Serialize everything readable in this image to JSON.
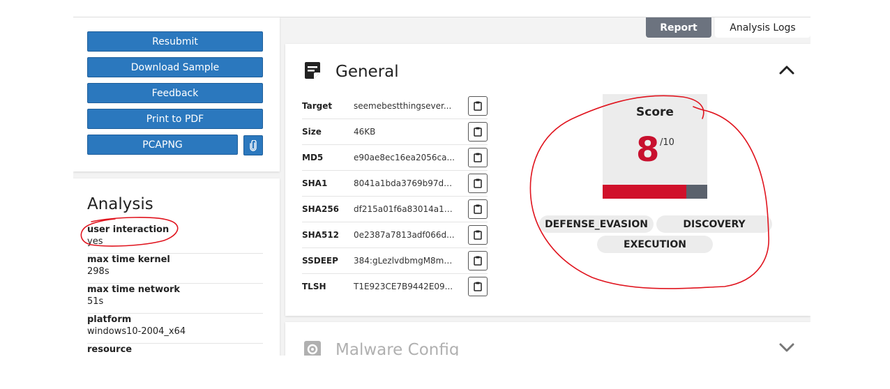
{
  "actions": {
    "resubmit": "Resubmit",
    "download": "Download Sample",
    "feedback": "Feedback",
    "print": "Print to PDF",
    "pcapng": "PCAPNG"
  },
  "analysis": {
    "title": "Analysis",
    "props": [
      {
        "key": "user interaction",
        "value": "yes"
      },
      {
        "key": "max time kernel",
        "value": "298s"
      },
      {
        "key": "max time network",
        "value": "51s"
      },
      {
        "key": "platform",
        "value": "windows10-2004_x64"
      },
      {
        "key": "resource",
        "value": ""
      }
    ]
  },
  "tabs": {
    "report": "Report",
    "logs": "Analysis Logs"
  },
  "general": {
    "title": "General",
    "rows": [
      {
        "key": "Target",
        "value": "seemebestthingsever..."
      },
      {
        "key": "Size",
        "value": "46KB"
      },
      {
        "key": "MD5",
        "value": "e90ae8ec16ea2056ca..."
      },
      {
        "key": "SHA1",
        "value": "8041a1bda3769b97d8..."
      },
      {
        "key": "SHA256",
        "value": "df215a01f6a83014a14..."
      },
      {
        "key": "SHA512",
        "value": "0e2387a7813adf066d..."
      },
      {
        "key": "SSDEEP",
        "value": "384:gLezlvdbmgM8m9..."
      },
      {
        "key": "TLSH",
        "value": "T1E923CE7B9442E09..."
      }
    ],
    "score": {
      "label": "Score",
      "value": "8",
      "max": "/10",
      "fraction": 0.8
    },
    "tags": [
      "DEFENSE_EVASION",
      "DISCOVERY",
      "EXECUTION"
    ]
  },
  "malware": {
    "title": "Malware Config"
  },
  "colors": {
    "button": "#2b78be",
    "score_red": "#c8102e",
    "annotation_red": "#e0141e",
    "tab_active": "#6c737f"
  }
}
